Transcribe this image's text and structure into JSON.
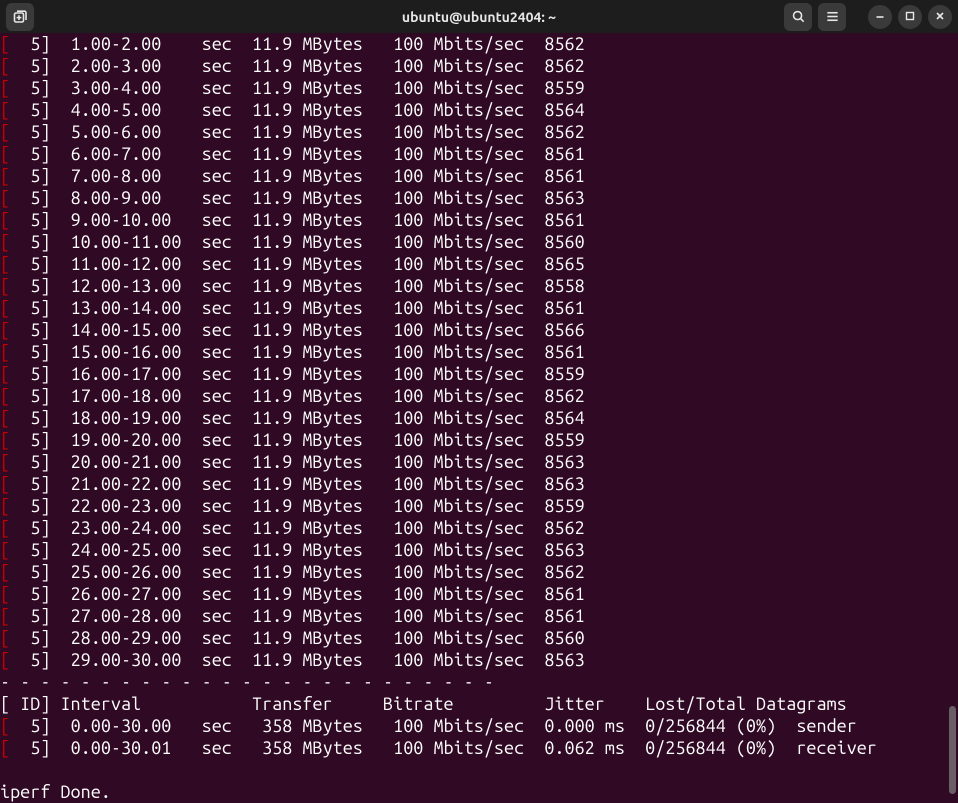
{
  "header": {
    "title": "ubuntu@ubuntu2404: ~",
    "new_tab_tooltip": "New Tab",
    "search_tooltip": "Search",
    "menu_tooltip": "Menu",
    "minimize_tooltip": "Minimize",
    "maximize_tooltip": "Maximize",
    "close_tooltip": "Close"
  },
  "output": {
    "intervals": [
      {
        "id": "5",
        "interval": "1.00-2.00",
        "unit": "sec",
        "transfer": "11.9 MBytes",
        "bitrate": "100 Mbits/sec",
        "dgrams": "8562"
      },
      {
        "id": "5",
        "interval": "2.00-3.00",
        "unit": "sec",
        "transfer": "11.9 MBytes",
        "bitrate": "100 Mbits/sec",
        "dgrams": "8562"
      },
      {
        "id": "5",
        "interval": "3.00-4.00",
        "unit": "sec",
        "transfer": "11.9 MBytes",
        "bitrate": "100 Mbits/sec",
        "dgrams": "8559"
      },
      {
        "id": "5",
        "interval": "4.00-5.00",
        "unit": "sec",
        "transfer": "11.9 MBytes",
        "bitrate": "100 Mbits/sec",
        "dgrams": "8564"
      },
      {
        "id": "5",
        "interval": "5.00-6.00",
        "unit": "sec",
        "transfer": "11.9 MBytes",
        "bitrate": "100 Mbits/sec",
        "dgrams": "8562"
      },
      {
        "id": "5",
        "interval": "6.00-7.00",
        "unit": "sec",
        "transfer": "11.9 MBytes",
        "bitrate": "100 Mbits/sec",
        "dgrams": "8561"
      },
      {
        "id": "5",
        "interval": "7.00-8.00",
        "unit": "sec",
        "transfer": "11.9 MBytes",
        "bitrate": "100 Mbits/sec",
        "dgrams": "8561"
      },
      {
        "id": "5",
        "interval": "8.00-9.00",
        "unit": "sec",
        "transfer": "11.9 MBytes",
        "bitrate": "100 Mbits/sec",
        "dgrams": "8563"
      },
      {
        "id": "5",
        "interval": "9.00-10.00",
        "unit": "sec",
        "transfer": "11.9 MBytes",
        "bitrate": "100 Mbits/sec",
        "dgrams": "8561"
      },
      {
        "id": "5",
        "interval": "10.00-11.00",
        "unit": "sec",
        "transfer": "11.9 MBytes",
        "bitrate": "100 Mbits/sec",
        "dgrams": "8560"
      },
      {
        "id": "5",
        "interval": "11.00-12.00",
        "unit": "sec",
        "transfer": "11.9 MBytes",
        "bitrate": "100 Mbits/sec",
        "dgrams": "8565"
      },
      {
        "id": "5",
        "interval": "12.00-13.00",
        "unit": "sec",
        "transfer": "11.9 MBytes",
        "bitrate": "100 Mbits/sec",
        "dgrams": "8558"
      },
      {
        "id": "5",
        "interval": "13.00-14.00",
        "unit": "sec",
        "transfer": "11.9 MBytes",
        "bitrate": "100 Mbits/sec",
        "dgrams": "8561"
      },
      {
        "id": "5",
        "interval": "14.00-15.00",
        "unit": "sec",
        "transfer": "11.9 MBytes",
        "bitrate": "100 Mbits/sec",
        "dgrams": "8566"
      },
      {
        "id": "5",
        "interval": "15.00-16.00",
        "unit": "sec",
        "transfer": "11.9 MBytes",
        "bitrate": "100 Mbits/sec",
        "dgrams": "8561"
      },
      {
        "id": "5",
        "interval": "16.00-17.00",
        "unit": "sec",
        "transfer": "11.9 MBytes",
        "bitrate": "100 Mbits/sec",
        "dgrams": "8559"
      },
      {
        "id": "5",
        "interval": "17.00-18.00",
        "unit": "sec",
        "transfer": "11.9 MBytes",
        "bitrate": "100 Mbits/sec",
        "dgrams": "8562"
      },
      {
        "id": "5",
        "interval": "18.00-19.00",
        "unit": "sec",
        "transfer": "11.9 MBytes",
        "bitrate": "100 Mbits/sec",
        "dgrams": "8564"
      },
      {
        "id": "5",
        "interval": "19.00-20.00",
        "unit": "sec",
        "transfer": "11.9 MBytes",
        "bitrate": "100 Mbits/sec",
        "dgrams": "8559"
      },
      {
        "id": "5",
        "interval": "20.00-21.00",
        "unit": "sec",
        "transfer": "11.9 MBytes",
        "bitrate": "100 Mbits/sec",
        "dgrams": "8563"
      },
      {
        "id": "5",
        "interval": "21.00-22.00",
        "unit": "sec",
        "transfer": "11.9 MBytes",
        "bitrate": "100 Mbits/sec",
        "dgrams": "8563"
      },
      {
        "id": "5",
        "interval": "22.00-23.00",
        "unit": "sec",
        "transfer": "11.9 MBytes",
        "bitrate": "100 Mbits/sec",
        "dgrams": "8559"
      },
      {
        "id": "5",
        "interval": "23.00-24.00",
        "unit": "sec",
        "transfer": "11.9 MBytes",
        "bitrate": "100 Mbits/sec",
        "dgrams": "8562"
      },
      {
        "id": "5",
        "interval": "24.00-25.00",
        "unit": "sec",
        "transfer": "11.9 MBytes",
        "bitrate": "100 Mbits/sec",
        "dgrams": "8563"
      },
      {
        "id": "5",
        "interval": "25.00-26.00",
        "unit": "sec",
        "transfer": "11.9 MBytes",
        "bitrate": "100 Mbits/sec",
        "dgrams": "8562"
      },
      {
        "id": "5",
        "interval": "26.00-27.00",
        "unit": "sec",
        "transfer": "11.9 MBytes",
        "bitrate": "100 Mbits/sec",
        "dgrams": "8561"
      },
      {
        "id": "5",
        "interval": "27.00-28.00",
        "unit": "sec",
        "transfer": "11.9 MBytes",
        "bitrate": "100 Mbits/sec",
        "dgrams": "8561"
      },
      {
        "id": "5",
        "interval": "28.00-29.00",
        "unit": "sec",
        "transfer": "11.9 MBytes",
        "bitrate": "100 Mbits/sec",
        "dgrams": "8560"
      },
      {
        "id": "5",
        "interval": "29.00-30.00",
        "unit": "sec",
        "transfer": "11.9 MBytes",
        "bitrate": "100 Mbits/sec",
        "dgrams": "8563"
      }
    ],
    "divider": "- - - - - - - - - - - - - - - - - - - - - - - - -",
    "summary_header": "[ ID] Interval           Transfer     Bitrate         Jitter    Lost/Total Datagrams",
    "summary": [
      {
        "id": "5",
        "interval": "0.00-30.00",
        "unit": "sec",
        "transfer": "358 MBytes",
        "bitrate": "100 Mbits/sec",
        "jitter": "0.000 ms",
        "lost": "0/256844 (0%)",
        "role": "sender"
      },
      {
        "id": "5",
        "interval": "0.00-30.01",
        "unit": "sec",
        "transfer": "358 MBytes",
        "bitrate": "100 Mbits/sec",
        "jitter": "0.062 ms",
        "lost": "0/256844 (0%)",
        "role": "receiver"
      }
    ],
    "done": "iperf Done."
  }
}
